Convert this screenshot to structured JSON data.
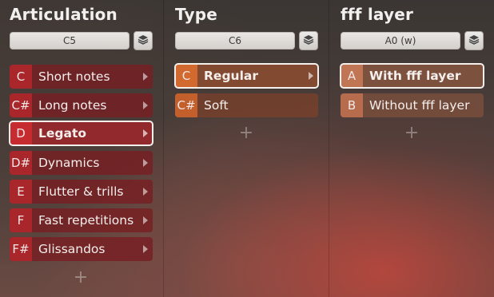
{
  "columns": [
    {
      "title": "Articulation",
      "key_field": "C5",
      "items": [
        {
          "key": "C",
          "label": "Short notes",
          "has_submenu": true
        },
        {
          "key": "C#",
          "label": "Long notes",
          "has_submenu": true
        },
        {
          "key": "D",
          "label": "Legato",
          "has_submenu": true,
          "selected": true
        },
        {
          "key": "D#",
          "label": "Dynamics",
          "has_submenu": true
        },
        {
          "key": "E",
          "label": "Flutter & trills",
          "has_submenu": true
        },
        {
          "key": "F",
          "label": "Fast repetitions",
          "has_submenu": true
        },
        {
          "key": "F#",
          "label": "Glissandos",
          "has_submenu": true
        }
      ],
      "add_symbol": "+"
    },
    {
      "title": "Type",
      "key_field": "C6",
      "items": [
        {
          "key": "C",
          "label": "Regular",
          "has_submenu": true,
          "selected": true
        },
        {
          "key": "C#",
          "label": "Soft",
          "has_submenu": false
        }
      ],
      "add_symbol": "+"
    },
    {
      "title": "fff layer",
      "key_field": "A0 (w)",
      "items": [
        {
          "key": "A",
          "label": "With fff layer",
          "has_submenu": false,
          "selected": true
        },
        {
          "key": "B",
          "label": "Without fff layer",
          "has_submenu": false
        }
      ],
      "add_symbol": "+"
    }
  ],
  "icons": {
    "layers": "layers-icon",
    "submenu": "chevron-right-icon",
    "add": "plus-icon"
  },
  "colors": {
    "articulation_key": "#a9262b",
    "type_key": "#c35f2b",
    "fff_key": "#b66c4d",
    "selected_outline": "#f2efed"
  }
}
